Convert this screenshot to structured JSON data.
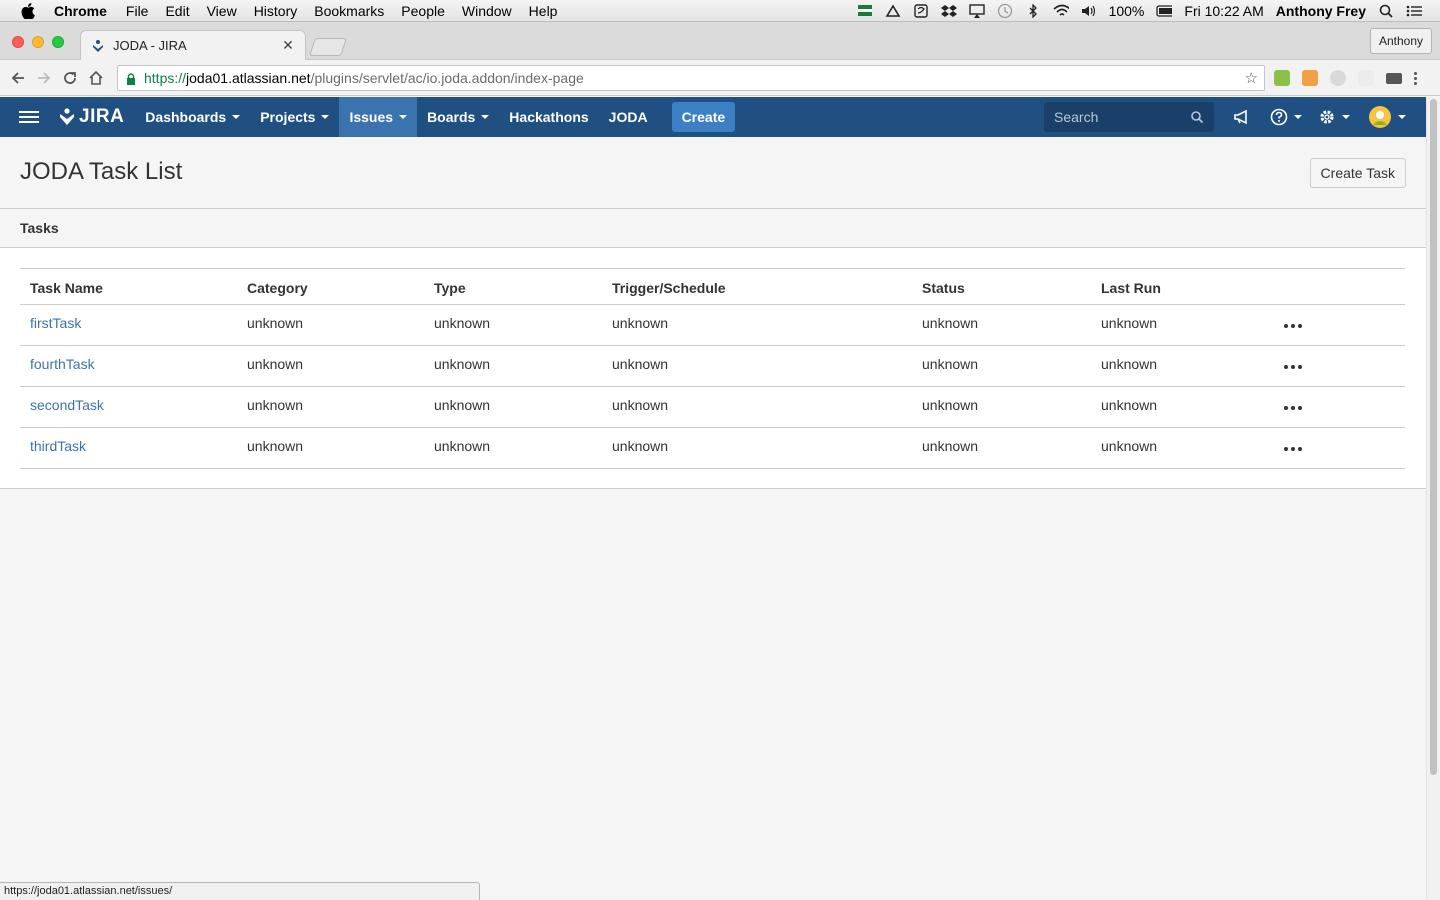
{
  "os_menubar": {
    "app_name": "Chrome",
    "menus": [
      "File",
      "Edit",
      "View",
      "History",
      "Bookmarks",
      "People",
      "Window",
      "Help"
    ],
    "battery": "100%",
    "clock": "Fri 10:22 AM",
    "user": "Anthony Frey"
  },
  "browser": {
    "tab_title": "JODA - JIRA",
    "profile": "Anthony",
    "url_scheme": "https://",
    "url_host": "joda01.atlassian.net",
    "url_path": "/plugins/servlet/ac/io.joda.addon/index-page",
    "status_url": "https://joda01.atlassian.net/issues/"
  },
  "jira_nav": {
    "logo": "JIRA",
    "items": [
      {
        "label": "Dashboards",
        "dropdown": true,
        "active": false
      },
      {
        "label": "Projects",
        "dropdown": true,
        "active": false
      },
      {
        "label": "Issues",
        "dropdown": true,
        "active": true
      },
      {
        "label": "Boards",
        "dropdown": true,
        "active": false
      },
      {
        "label": "Hackathons",
        "dropdown": false,
        "active": false
      },
      {
        "label": "JODA",
        "dropdown": false,
        "active": false
      }
    ],
    "create_label": "Create",
    "search_placeholder": "Search"
  },
  "page": {
    "title": "JODA Task List",
    "create_task_label": "Create Task",
    "tab_label": "Tasks"
  },
  "table": {
    "headers": [
      "Task Name",
      "Category",
      "Type",
      "Trigger/Schedule",
      "Status",
      "Last Run"
    ],
    "rows": [
      {
        "name": "firstTask",
        "category": "unknown",
        "type": "unknown",
        "trigger": "unknown",
        "status": "unknown",
        "last_run": "unknown"
      },
      {
        "name": "fourthTask",
        "category": "unknown",
        "type": "unknown",
        "trigger": "unknown",
        "status": "unknown",
        "last_run": "unknown"
      },
      {
        "name": "secondTask",
        "category": "unknown",
        "type": "unknown",
        "trigger": "unknown",
        "status": "unknown",
        "last_run": "unknown"
      },
      {
        "name": "thirdTask",
        "category": "unknown",
        "type": "unknown",
        "trigger": "unknown",
        "status": "unknown",
        "last_run": "unknown"
      }
    ]
  },
  "colors": {
    "jira_header": "#205081",
    "active_nav": "#3b73af",
    "create_button": "#3b7fc4",
    "link": "#3b73af"
  }
}
